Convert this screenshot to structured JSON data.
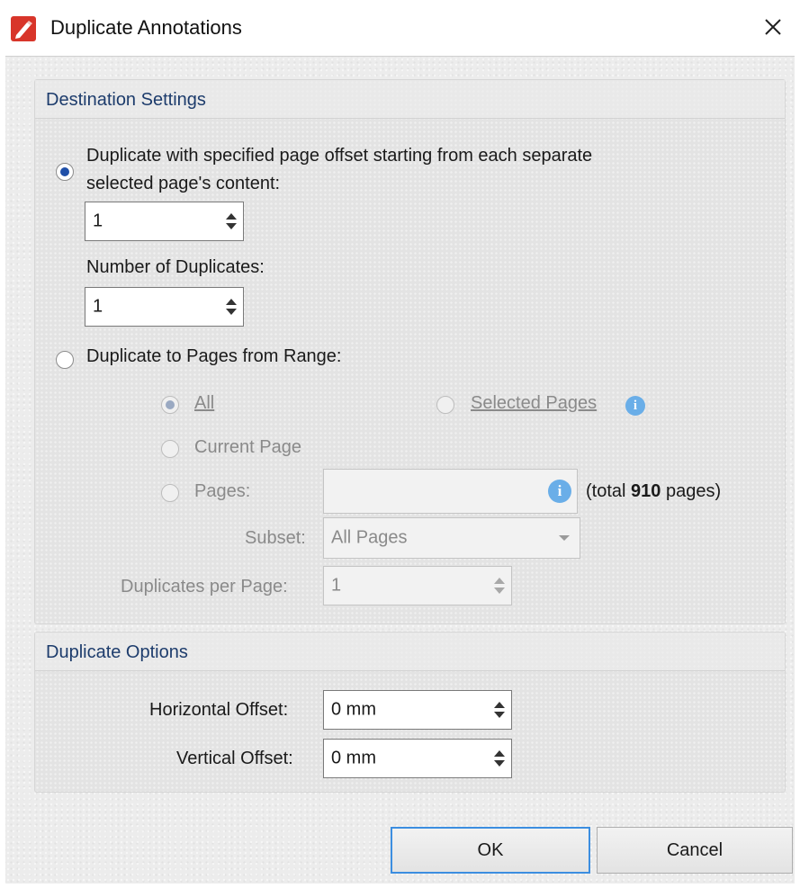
{
  "window": {
    "title": "Duplicate Annotations"
  },
  "destination": {
    "header": "Destination Settings",
    "option1_label_line1": "Duplicate with specified page offset starting from each separate",
    "option1_label_line2": "selected page's content:",
    "offset_value": "1",
    "num_dup_label": "Number of Duplicates:",
    "num_dup_value": "1",
    "option2_label": "Duplicate to Pages from Range:",
    "all_label": "All",
    "selected_pages_label": "Selected Pages",
    "current_page_label": "Current Page",
    "pages_label": "Pages:",
    "pages_value": "",
    "total_prefix": "(total ",
    "total_count": "910",
    "total_suffix": " pages)",
    "subset_label": "Subset:",
    "subset_value": "All Pages",
    "dup_per_page_label": "Duplicates per Page:",
    "dup_per_page_value": "1"
  },
  "options": {
    "header": "Duplicate Options",
    "horizontal_label": "Horizontal Offset:",
    "horizontal_value": "0 mm",
    "vertical_label": "Vertical Offset:",
    "vertical_value": "0 mm"
  },
  "buttons": {
    "ok": "OK",
    "cancel": "Cancel"
  },
  "selection": {
    "option1_selected": true,
    "range_all_selected": true
  },
  "colors": {
    "accent": "#1f4fa8",
    "info": "#6aaee8",
    "header_text": "#1d3c6c",
    "app_icon": "#d8352a"
  },
  "icons": {
    "app": "pdf-editor-icon",
    "close": "close-icon",
    "info": "info-icon"
  }
}
